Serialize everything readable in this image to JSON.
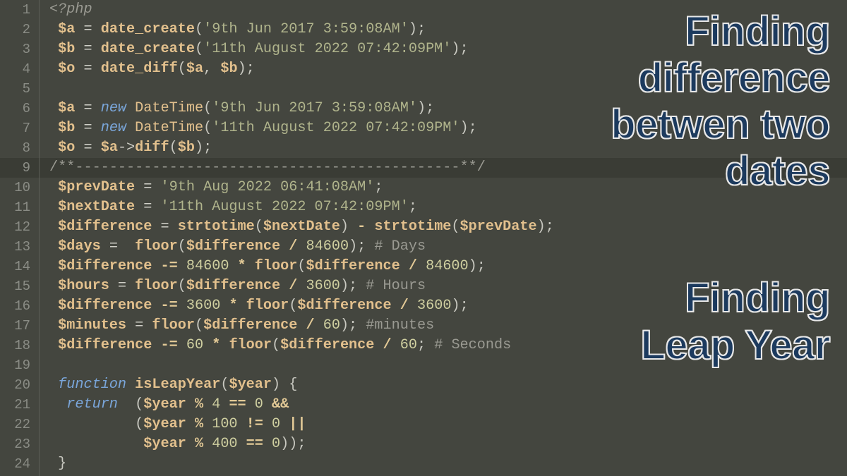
{
  "lines": [
    1,
    2,
    3,
    4,
    5,
    6,
    7,
    8,
    9,
    10,
    11,
    12,
    13,
    14,
    15,
    16,
    17,
    18,
    19,
    20,
    21,
    22,
    23,
    24
  ],
  "highlight_line": 9,
  "overlays": {
    "title1_l1": "Finding",
    "title1_l2": "difference",
    "title1_l3": "betwen two",
    "title1_l4": "dates",
    "title2_l1": "Finding",
    "title2_l2": "Leap Year"
  },
  "code": {
    "l1_php": "<?php",
    "l2_a": "$a",
    "l2_eq": " = ",
    "l2_fn": "date_create",
    "l2_po": "(",
    "l2_str": "'9th Jun 2017 3:59:08AM'",
    "l2_pc": ");",
    "l3_a": "$b",
    "l3_eq": " = ",
    "l3_fn": "date_create",
    "l3_po": "(",
    "l3_str": "'11th August 2022 07:42:09PM'",
    "l3_pc": ");",
    "l4_a": "$o",
    "l4_eq": " = ",
    "l4_fn": "date_diff",
    "l4_po": "(",
    "l4_v1": "$a",
    "l4_c": ", ",
    "l4_v2": "$b",
    "l4_pc": ");",
    "l6_a": "$a",
    "l6_eq": " = ",
    "l6_new": "new",
    "l6_sp": " ",
    "l6_cls": "DateTime",
    "l6_po": "(",
    "l6_str": "'9th Jun 2017 3:59:08AM'",
    "l6_pc": ");",
    "l7_a": "$b",
    "l7_eq": " = ",
    "l7_new": "new",
    "l7_sp": " ",
    "l7_cls": "DateTime",
    "l7_po": "(",
    "l7_str": "'11th August 2022 07:42:09PM'",
    "l7_pc": ");",
    "l8_a": "$o",
    "l8_eq": " = ",
    "l8_v1": "$a",
    "l8_ar": "->",
    "l8_fn": "diff",
    "l8_po": "(",
    "l8_v2": "$b",
    "l8_pc": ");",
    "l9_cmt": "/**---------------------------------------------**/",
    "l10_v": "$prevDate",
    "l10_eq": " = ",
    "l10_str": "'9th Aug 2022 06:41:08AM'",
    "l10_sc": ";",
    "l11_v": "$nextDate",
    "l11_eq": " = ",
    "l11_str": "'11th August 2022 07:42:09PM'",
    "l11_sc": ";",
    "l12_v": "$difference",
    "l12_eq": " = ",
    "l12_fn1": "strtotime",
    "l12_po1": "(",
    "l12_a1": "$nextDate",
    "l12_pc1": ")",
    "l12_m": " - ",
    "l12_fn2": "strtotime",
    "l12_po2": "(",
    "l12_a2": "$prevDate",
    "l12_pc2": ");",
    "l13_v": "$days",
    "l13_eq": " =  ",
    "l13_fn": "floor",
    "l13_po": "(",
    "l13_a": "$difference",
    "l13_d": " / ",
    "l13_n": "84600",
    "l13_pc": "); ",
    "l13_c": "# Days",
    "l14_v": "$difference",
    "l14_eq": " -= ",
    "l14_n1": "84600",
    "l14_m": " * ",
    "l14_fn": "floor",
    "l14_po": "(",
    "l14_a": "$difference",
    "l14_d": " / ",
    "l14_n2": "84600",
    "l14_pc": ");",
    "l15_v": "$hours",
    "l15_eq": " = ",
    "l15_fn": "floor",
    "l15_po": "(",
    "l15_a": "$difference",
    "l15_d": " / ",
    "l15_n": "3600",
    "l15_pc": "); ",
    "l15_c": "# Hours",
    "l16_v": "$difference",
    "l16_eq": " -= ",
    "l16_n1": "3600",
    "l16_m": " * ",
    "l16_fn": "floor",
    "l16_po": "(",
    "l16_a": "$difference",
    "l16_d": " / ",
    "l16_n2": "3600",
    "l16_pc": ");",
    "l17_v": "$minutes",
    "l17_eq": " = ",
    "l17_fn": "floor",
    "l17_po": "(",
    "l17_a": "$difference",
    "l17_d": " / ",
    "l17_n": "60",
    "l17_pc": "); ",
    "l17_c": "#minutes",
    "l18_v": "$difference",
    "l18_eq": " -= ",
    "l18_n1": "60",
    "l18_m": " * ",
    "l18_fn": "floor",
    "l18_po": "(",
    "l18_a": "$difference",
    "l18_d": " / ",
    "l18_n2": "60",
    "l18_pc": "; ",
    "l18_c": "# Seconds",
    "l20_kw": "function",
    "l20_sp": " ",
    "l20_fn": "isLeapYear",
    "l20_po": "(",
    "l20_a": "$year",
    "l20_pc": ")",
    "l20_ob": " {",
    "l21_kw": " return",
    "l21_sp": "  (",
    "l21_a": "$year",
    "l21_m": " % ",
    "l21_n": "4",
    "l21_eq": " == ",
    "l21_z": "0",
    "l21_and": " &&",
    "l22_sp": "         (",
    "l22_a": "$year",
    "l22_m": " % ",
    "l22_n": "100",
    "l22_ne": " != ",
    "l22_z": "0",
    "l22_or": " ||",
    "l23_sp": "          ",
    "l23_a": "$year",
    "l23_m": " % ",
    "l23_n": "400",
    "l23_eq": " == ",
    "l23_z": "0",
    "l23_pc": "));",
    "l24_cb": "}"
  }
}
